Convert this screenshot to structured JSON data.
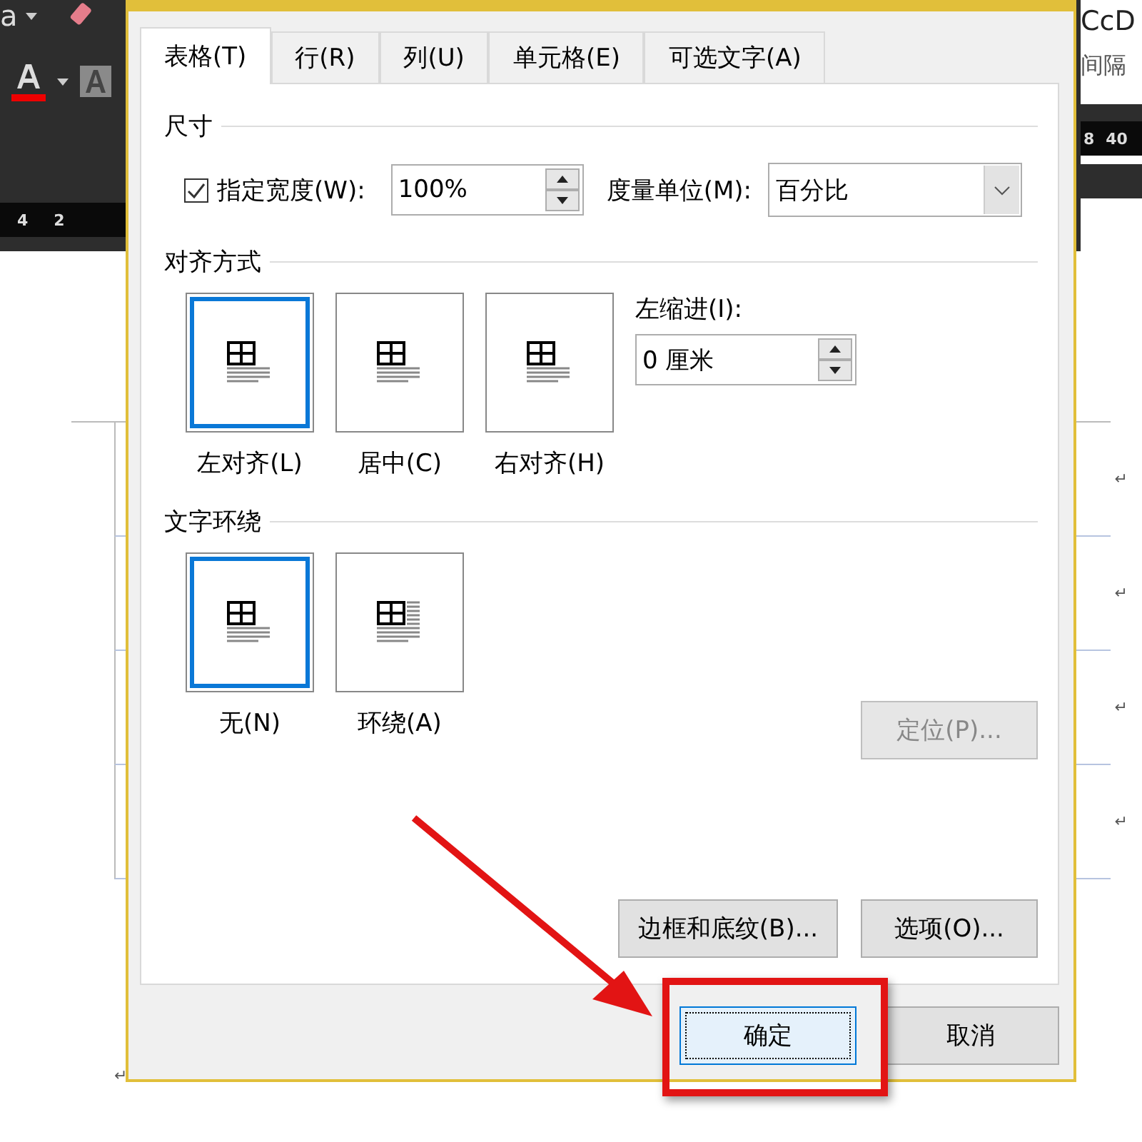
{
  "background_app": {
    "left_ribbon": {
      "font_label": "a",
      "ruler_numbers": [
        "4",
        "2"
      ]
    },
    "right_ribbon": {
      "style_preview": "CcD",
      "spacing_label": "间隔",
      "ruler_numbers": [
        "8",
        "40"
      ]
    },
    "document": {
      "return_marks": [
        "↵",
        "↵",
        "↵",
        "↵"
      ],
      "end_mark": "↵"
    }
  },
  "tabs": [
    {
      "label": "表格(T)",
      "selected": true
    },
    {
      "label": "行(R)",
      "selected": false
    },
    {
      "label": "列(U)",
      "selected": false
    },
    {
      "label": "单元格(E)",
      "selected": false
    },
    {
      "label": "可选文字(A)",
      "selected": false
    }
  ],
  "size_section": {
    "title": "尺寸",
    "preferred_width": {
      "label": "指定宽度(W):",
      "checked": true,
      "value": "100%"
    },
    "measure": {
      "label": "度量单位(M):",
      "value": "百分比"
    }
  },
  "alignment_section": {
    "title": "对齐方式",
    "options": [
      {
        "label": "左对齐(L)",
        "selected": true
      },
      {
        "label": "居中(C)",
        "selected": false
      },
      {
        "label": "右对齐(H)",
        "selected": false
      }
    ],
    "indent": {
      "label": "左缩进(I):",
      "value": "0 厘米"
    }
  },
  "wrap_section": {
    "title": "文字环绕",
    "options": [
      {
        "label": "无(N)",
        "kind": "none",
        "selected": true
      },
      {
        "label": "环绕(A)",
        "kind": "around",
        "selected": false
      }
    ],
    "position_button": {
      "label": "定位(P)...",
      "disabled": true
    }
  },
  "panel_buttons": [
    "边框和底纹(B)...",
    "选项(O)..."
  ],
  "dialog_buttons": [
    {
      "label": "确定",
      "default": true
    },
    {
      "label": "取消",
      "default": false
    }
  ],
  "annotation": {
    "highlight": true
  }
}
